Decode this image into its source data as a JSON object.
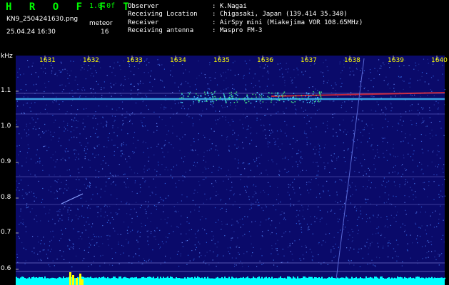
{
  "header": {
    "title": "H R O F F T",
    "version": "1.0.0f",
    "filename": "KN9_2504241630.png",
    "meteor_label": "meteor",
    "datetime": "25.04.24 16:30",
    "meteor_count": "16"
  },
  "info": [
    {
      "label": "Observer",
      "value": ": K.Nagai"
    },
    {
      "label": "Receiving Location",
      "value": ": Chigasaki, Japan (139.414 35.340)"
    },
    {
      "label": "Receiver",
      "value": ": AirSpy mini (Miakejima VOR 108.65MHz)"
    },
    {
      "label": "Receiving antenna",
      "value": ": Maspro FM-3"
    }
  ],
  "axes": {
    "y_unit": "kHz",
    "x_ticks": [
      "1631",
      "1632",
      "1633",
      "1634",
      "1635",
      "1636",
      "1637",
      "1638",
      "1639",
      "1640"
    ],
    "y_ticks": [
      "1.1",
      "1.0",
      "0.9",
      "0.8",
      "0.7",
      "0.6"
    ]
  },
  "colors": {
    "background": "#0a0a6a",
    "tick_x": "#ffff00",
    "signal_peak": "#ff3030",
    "noise_floor": "#00ffff",
    "meteor_bar": "#ffff00"
  }
}
